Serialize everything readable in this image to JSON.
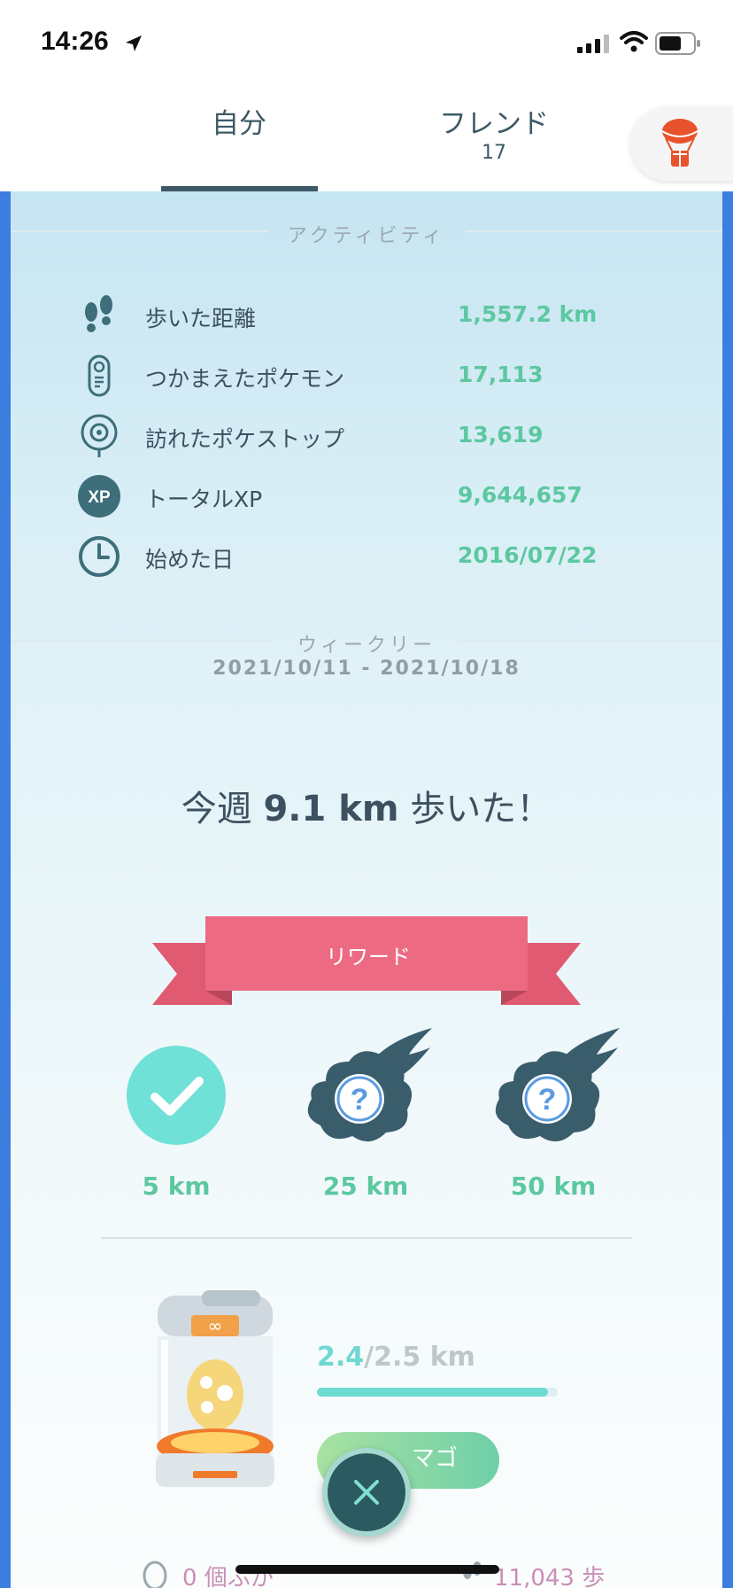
{
  "status_bar": {
    "time": "14:26"
  },
  "tabs": {
    "self_label": "自分",
    "friends_label": "フレンド",
    "friends_count": "17"
  },
  "activity": {
    "header": "アクティビティ",
    "stats": [
      {
        "icon": "footprints-icon",
        "label": "歩いた距離",
        "value": "1,557.2 km"
      },
      {
        "icon": "pokedex-icon",
        "label": "つかまえたポケモン",
        "value": "17,113"
      },
      {
        "icon": "pokestop-icon",
        "label": "訪れたポケストップ",
        "value": "13,619"
      },
      {
        "icon": "xp-icon",
        "label": "トータルXP",
        "value": "9,644,657",
        "icon_text": "XP"
      },
      {
        "icon": "clock-icon",
        "label": "始めた日",
        "value": "2016/07/22"
      }
    ]
  },
  "weekly": {
    "header": "ウィークリー",
    "range": "2021/10/11 - 2021/10/18",
    "headline_prefix": "今週 ",
    "headline_distance": "9.1 km",
    "headline_suffix": " 歩いた！"
  },
  "rewards": {
    "ribbon_label": "リワード",
    "items": [
      {
        "label": "5 km",
        "state": "claimed"
      },
      {
        "label": "25 km",
        "state": "locked",
        "mark": "?"
      },
      {
        "label": "50 km",
        "state": "locked",
        "mark": "?"
      }
    ]
  },
  "egg": {
    "progress_current": "2.4",
    "progress_total": "/2.5 km",
    "progress_fraction": 0.96,
    "button_label": "マゴ"
  },
  "footer": {
    "left_text": "0 個ふか",
    "right_text": "11,043 歩"
  },
  "colors": {
    "accent_green": "#5cc8a0",
    "side_border": "#3c7de0",
    "ribbon": "#e96a82",
    "dark_teal": "#2c5a61"
  }
}
